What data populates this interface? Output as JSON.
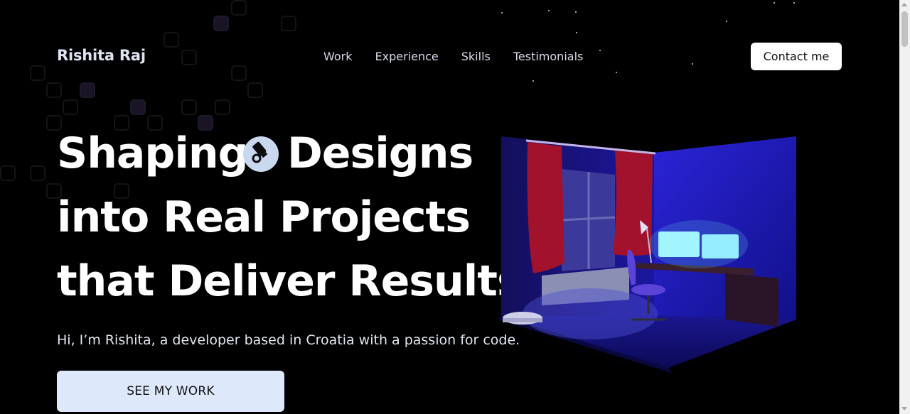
{
  "header": {
    "logo": "Rishita Raj",
    "nav": [
      "Work",
      "Experience",
      "Skills",
      "Testimonials"
    ],
    "contact_label": "Contact me"
  },
  "hero": {
    "line1_a": "Shaping",
    "line1_b": "Designs",
    "line2": "into Real Projects",
    "line3": "that Deliver Results",
    "design_icon": "design-tool-icon",
    "intro": "Hi, I’m Rishita, a developer based in Croatia with a passion for code.",
    "cta_label": "SEE MY WORK",
    "illustration": "3d-room-illustration"
  },
  "colors": {
    "background": "#000000",
    "cta_background": "#dde8fb",
    "room_wall": "#1a14b8",
    "monitor_glow": "#aef6ff"
  }
}
